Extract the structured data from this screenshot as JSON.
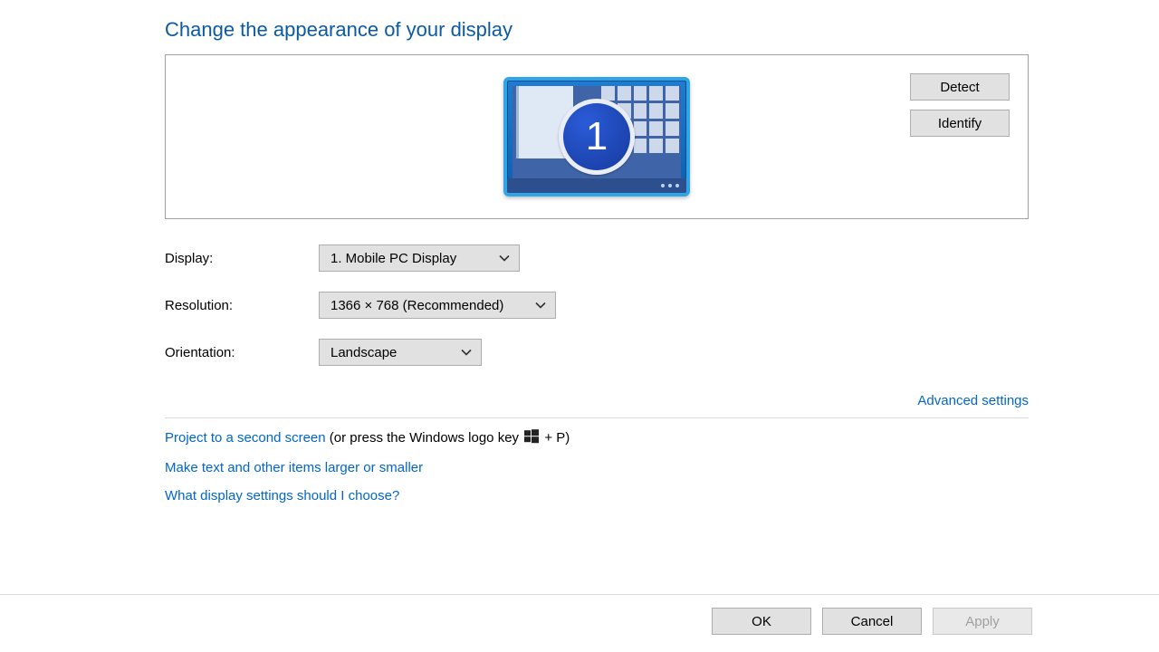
{
  "heading": "Change the appearance of your display",
  "display_preview": {
    "monitor_number": "1",
    "buttons": {
      "detect": "Detect",
      "identify": "Identify"
    }
  },
  "form": {
    "display": {
      "label": "Display:",
      "value": "1. Mobile PC Display"
    },
    "resolution": {
      "label": "Resolution:",
      "value": "1366 × 768 (Recommended)"
    },
    "orientation": {
      "label": "Orientation:",
      "value": "Landscape"
    }
  },
  "links": {
    "advanced": "Advanced settings",
    "project": "Project to a second screen",
    "project_hint_prefix": " (or press the Windows logo key ",
    "project_hint_suffix": " + P)",
    "text_size": "Make text and other items larger or smaller",
    "help": "What display settings should I choose?"
  },
  "footer": {
    "ok": "OK",
    "cancel": "Cancel",
    "apply": "Apply"
  }
}
